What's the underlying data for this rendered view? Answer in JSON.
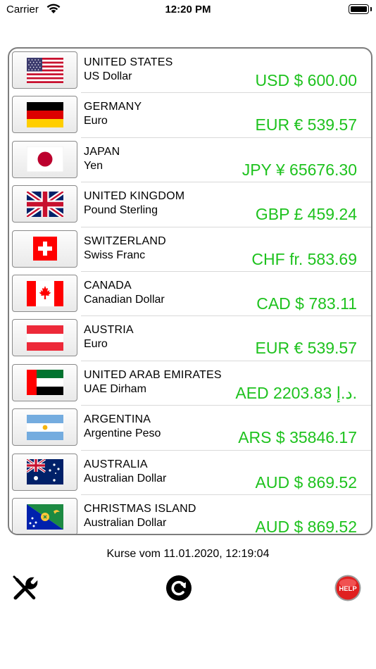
{
  "status_bar": {
    "carrier": "Carrier",
    "time": "12:20 PM"
  },
  "rows": [
    {
      "country": "UNITED STATES",
      "currency": "US Dollar",
      "amount": "USD $  600.00"
    },
    {
      "country": "GERMANY",
      "currency": "Euro",
      "amount": "EUR €  539.57"
    },
    {
      "country": "JAPAN",
      "currency": "Yen",
      "amount": "JPY ¥  65676.30"
    },
    {
      "country": "UNITED KINGDOM",
      "currency": "Pound Sterling",
      "amount": "GBP £  459.24"
    },
    {
      "country": "SWITZERLAND",
      "currency": "Swiss Franc",
      "amount": "CHF fr.  583.69"
    },
    {
      "country": "CANADA",
      "currency": "Canadian Dollar",
      "amount": "CAD $  783.11"
    },
    {
      "country": "AUSTRIA",
      "currency": "Euro",
      "amount": "EUR €  539.57"
    },
    {
      "country": "UNITED ARAB EMIRATES",
      "currency": "UAE Dirham",
      "amount": "AED 2203.83  د.إ."
    },
    {
      "country": "ARGENTINA",
      "currency": "Argentine Peso",
      "amount": "ARS $  35846.17"
    },
    {
      "country": "AUSTRALIA",
      "currency": "Australian Dollar",
      "amount": "AUD $  869.52"
    },
    {
      "country": "CHRISTMAS ISLAND",
      "currency": "Australian Dollar",
      "amount": "AUD $  869.52"
    }
  ],
  "footer": {
    "rates_date": "Kurse vom 11.01.2020, 12:19:04"
  },
  "colors": {
    "amount": "#1ec21e",
    "help_button": "#e02020"
  },
  "icons": {
    "settings": "tools-icon",
    "refresh": "refresh-icon",
    "help": "help-icon"
  }
}
